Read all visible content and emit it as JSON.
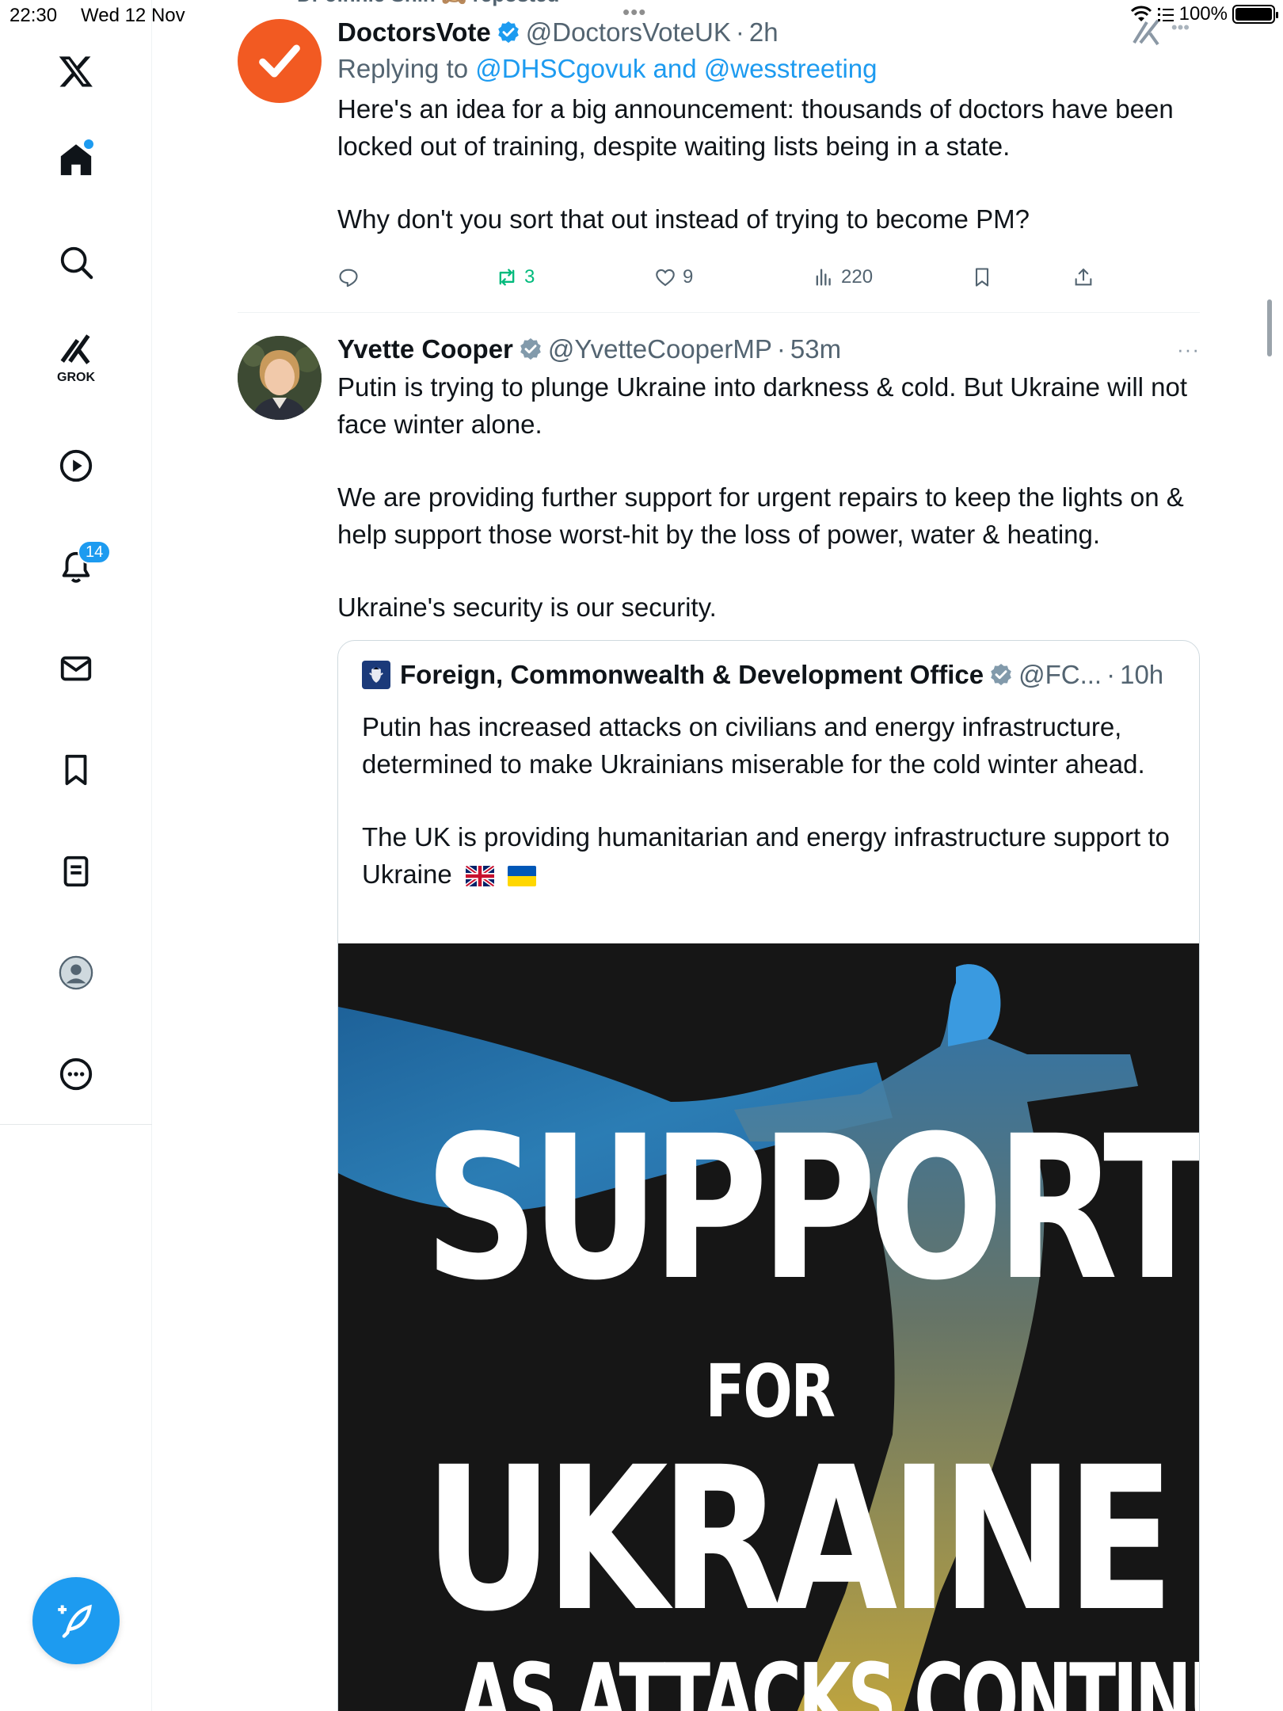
{
  "status_bar": {
    "time": "22:30",
    "date": "Wed 12 Nov",
    "battery": "100%"
  },
  "peek": {
    "repost_text": "Dr Jinnie Shin 🙈 reposted"
  },
  "sidebar": {
    "items": [
      {
        "icon": "x-logo-icon"
      },
      {
        "icon": "home-icon",
        "has_dot": true
      },
      {
        "icon": "search-icon"
      },
      {
        "icon": "grok-icon",
        "label": "GROK"
      },
      {
        "icon": "video-icon"
      },
      {
        "icon": "bell-icon",
        "badge": "14"
      },
      {
        "icon": "mail-icon"
      },
      {
        "icon": "bookmark-icon"
      },
      {
        "icon": "list-icon"
      },
      {
        "icon": "profile-icon"
      },
      {
        "icon": "more-icon"
      }
    ],
    "compose_icon": "compose-feather-icon"
  },
  "tweets": [
    {
      "name": "DoctorsVote",
      "handle": "@DoctorsVoteUK",
      "sep": "·",
      "time": "2h",
      "replying_prefix": "Replying to",
      "replying_to": "@DHSCgovuk and @wesstreeting",
      "text_p1": "Here's an idea for a big announcement: thousands of doctors have been locked out of training, despite waiting lists being in a state.",
      "text_p2": "Why don't you sort that out instead of trying to become PM?",
      "stats": {
        "reposts": "3",
        "likes": "9",
        "views": "220"
      }
    },
    {
      "name": "Yvette Cooper",
      "handle": "@YvetteCooperMP",
      "sep": "·",
      "time": "53m",
      "more": "···",
      "text_p1": "Putin is trying to plunge Ukraine into darkness & cold. But Ukraine will not face winter alone.",
      "text_p2": "We are providing further support for urgent repairs to keep the lights on & help support those worst-hit by the loss of power, water & heating.",
      "text_p3": "Ukraine's security is our security.",
      "quote": {
        "name": "Foreign, Commonwealth & Development Office",
        "handle": "@FC...",
        "sep": "·",
        "time": "10h",
        "text_p1": "Putin has increased attacks on civilians and energy infrastructure, determined to make Ukrainians miserable for the cold winter ahead.",
        "text_p2": "The UK is providing humanitarian and energy infrastructure support to Ukraine",
        "media": {
          "line1": "SUPPORT",
          "line2": "FOR",
          "line3": "UKRAINE",
          "line4": "AS ATTACKS CONTINUE"
        }
      }
    }
  ],
  "colors": {
    "accent": "#1d9bf0",
    "repost_green": "#00ba7c",
    "secondary_text": "#536471",
    "doctorsvote_orange": "#f25a22"
  }
}
